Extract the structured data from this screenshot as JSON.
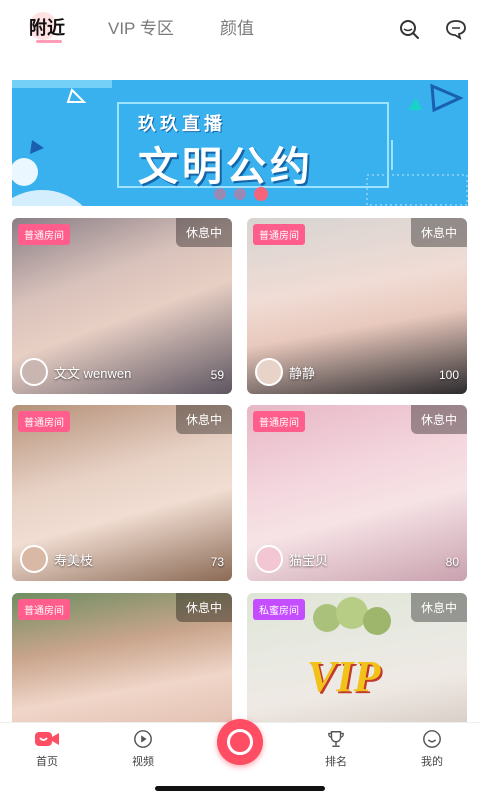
{
  "tabs": [
    {
      "label": "附近"
    },
    {
      "label": "VIP 专区"
    },
    {
      "label": "颜值"
    }
  ],
  "banner": {
    "title": "玖玖直播",
    "subtitle": "文明公约"
  },
  "cards": [
    {
      "badge": "普通房间",
      "status": "休息中",
      "name": "文文 wenwen",
      "count": "59"
    },
    {
      "badge": "普通房间",
      "status": "休息中",
      "name": "静静",
      "count": "100"
    },
    {
      "badge": "普通房间",
      "status": "休息中",
      "name": "寿美枝",
      "count": "73"
    },
    {
      "badge": "普通房间",
      "status": "休息中",
      "name": "猫宝贝",
      "count": "80"
    },
    {
      "badge": "普通房间",
      "status": "休息中"
    },
    {
      "badge": "私蜜房间",
      "status": "休息中",
      "watermark": "VIP"
    }
  ],
  "nav": [
    {
      "label": "首页",
      "icon": "home-live-icon"
    },
    {
      "label": "视频",
      "icon": "play-icon"
    },
    {
      "label": "",
      "icon": "go-live-icon"
    },
    {
      "label": "排名",
      "icon": "trophy-icon"
    },
    {
      "label": "我的",
      "icon": "profile-icon"
    }
  ],
  "colors": {
    "accent": "#ff4d63",
    "banner": "#39b1ee",
    "badge_normal": "#ff5e8c",
    "badge_private": "#c44dff"
  }
}
